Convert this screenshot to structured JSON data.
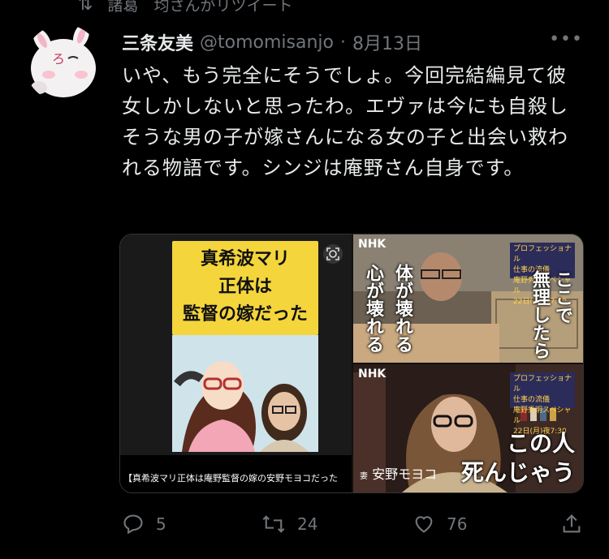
{
  "context": {
    "retweet_icon": "retweet-icon",
    "retweet_label": "諸葛　均さんがリツイート"
  },
  "tweet": {
    "author_name": "三条友美",
    "handle": "@tomomisanjo",
    "separator": "·",
    "date": "8月13日",
    "more_label": "•••",
    "text": "いや、もう完全にそうでしょ。今回完結編見て彼女しかしないと思ったわ。エヴァは今にも自殺しそうな男の子が嫁さんになる女の子と出会い救われる物語です。シンジは庵野さん自身です。"
  },
  "media": {
    "tile1": {
      "headline_lines": [
        "真希波マリ",
        "正体は",
        "監督の嫁だった"
      ],
      "caption": "【真希波マリ正体は庵野監督の嫁の安野モヨコだった"
    },
    "tile2": {
      "logo": "NHK",
      "badge": [
        "プロフェッショナル",
        "仕事の流儀",
        "庵野秀明スペシャル",
        "22日(月)夜7:30"
      ],
      "vertical_left": [
        "体が壊れる",
        "心が壊れる"
      ],
      "vertical_right": [
        "ここで",
        "無理したら"
      ]
    },
    "tile3": {
      "logo": "NHK",
      "badge": [
        "プロフェッショナル",
        "仕事の流儀",
        "庵野秀明スペシャル",
        "22日(月)夜7:30"
      ],
      "name_prefix": "妻",
      "name": "安野モヨコ",
      "line1": "この人",
      "line2": "死んじゃう"
    }
  },
  "actions": {
    "reply_count": "5",
    "retweet_count": "24",
    "like_count": "76"
  },
  "colors": {
    "background": "#000000",
    "text": "#e7e9ea",
    "muted": "#71767b",
    "headline_bg": "#f4d53c"
  }
}
